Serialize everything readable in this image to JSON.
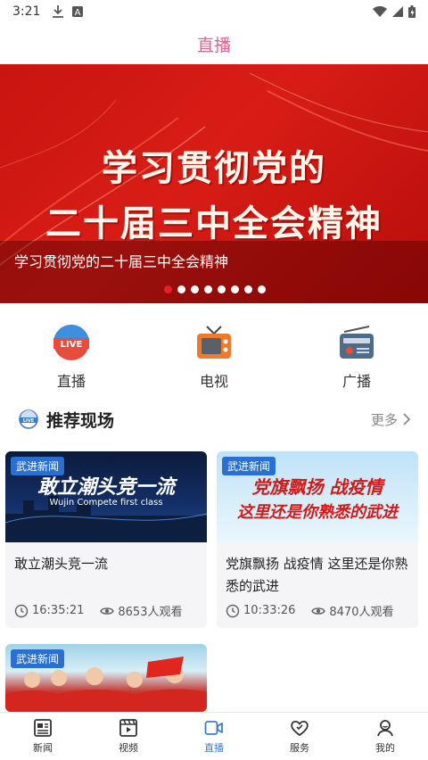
{
  "status_bar": {
    "time": "3:21"
  },
  "header": {
    "title": "直播"
  },
  "banner": {
    "headline_line1": "学习贯彻党的",
    "headline_line2": "二十届三中全会精神",
    "caption": "学习贯彻党的二十届三中全会精神",
    "dots_total": 8,
    "active_dot": 1
  },
  "quick_nav": [
    {
      "label": "直播",
      "icon": "live-tv-icon"
    },
    {
      "label": "电视",
      "icon": "television-icon"
    },
    {
      "label": "广播",
      "icon": "radio-icon"
    }
  ],
  "section": {
    "title": "推荐现场",
    "more": "更多"
  },
  "cards": [
    {
      "tag": "武进新闻",
      "thumb_text": "敢立潮头竞一流",
      "thumb_subtext": "Wujin Compete first class",
      "title": "敢立潮头竞一流",
      "duration": "16:35:21",
      "views": "8653人观看"
    },
    {
      "tag": "武进新闻",
      "thumb_text": "党旗飘扬 战疫情",
      "thumb_subtext": "这里还是你熟悉的武进",
      "title": "党旗飘扬 战疫情 这里还是你熟悉的武进",
      "duration": "10:33:26",
      "views": "8470人观看"
    },
    {
      "tag": "武进新闻"
    }
  ],
  "tabbar": [
    {
      "label": "新闻",
      "icon": "news-icon",
      "active": false
    },
    {
      "label": "视频",
      "icon": "video-icon",
      "active": false
    },
    {
      "label": "直播",
      "icon": "live-icon",
      "active": true
    },
    {
      "label": "服务",
      "icon": "service-icon",
      "active": false
    },
    {
      "label": "我的",
      "icon": "profile-icon",
      "active": false
    }
  ],
  "colors": {
    "header_title": "#e4618a",
    "banner_red": "#d81d16",
    "tag_blue": "#2b6fd1",
    "tab_active": "#3a7bd5"
  }
}
